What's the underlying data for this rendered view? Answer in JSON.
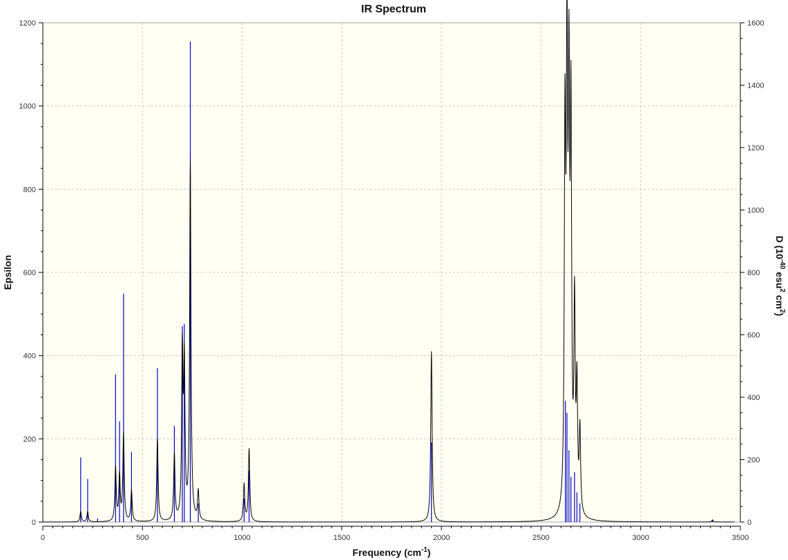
{
  "chart_data": {
    "type": "line",
    "title": "IR Spectrum",
    "xlabel": "Frequency (cm",
    "xlabel_sup": "-1",
    "xlabel_tail": ")",
    "ylabel": "Epsilon",
    "y2label": {
      "a": "D (10",
      "a_sup": "-40",
      "b": " esu",
      "b_sup": "2",
      "c": " cm",
      "c_sup": "2",
      "d": ")"
    },
    "xlim": [
      0,
      3500
    ],
    "ylim": [
      0,
      1200
    ],
    "y2lim": [
      0,
      1600
    ],
    "x_ticks": [
      0,
      500,
      1000,
      1500,
      2000,
      2500,
      3000,
      3500
    ],
    "y_ticks": [
      0,
      200,
      400,
      600,
      800,
      1000,
      1200
    ],
    "y2_ticks": [
      0,
      200,
      400,
      600,
      800,
      1000,
      1200,
      1400,
      1600
    ],
    "grid": true,
    "colors": {
      "spectrum": "#000000",
      "sticks": "#0000c8",
      "plot_bg": "#fffff4",
      "grid": "#c8c8c8"
    },
    "series": [
      {
        "kind": "stick",
        "axis": "y2",
        "x": [
          190,
          225,
          275,
          365,
          385,
          405,
          445,
          575,
          660,
          700,
          710,
          740,
          780,
          1010,
          1035,
          1950,
          2622,
          2630,
          2640,
          2650,
          2668,
          2680,
          2695,
          3360
        ],
        "values": [
          207,
          138,
          12,
          473,
          323,
          732,
          225,
          493,
          308,
          628,
          635,
          1540,
          60,
          75,
          165,
          255,
          388,
          350,
          230,
          145,
          160,
          95,
          60,
          8
        ]
      },
      {
        "kind": "spectrum",
        "axis": "y",
        "peaks": [
          {
            "x": 190,
            "height": 25,
            "width": 8
          },
          {
            "x": 225,
            "height": 25,
            "width": 8
          },
          {
            "x": 365,
            "height": 130,
            "width": 8
          },
          {
            "x": 385,
            "height": 110,
            "width": 8
          },
          {
            "x": 405,
            "height": 210,
            "width": 8
          },
          {
            "x": 445,
            "height": 75,
            "width": 8
          },
          {
            "x": 575,
            "height": 200,
            "width": 8
          },
          {
            "x": 660,
            "height": 160,
            "width": 8
          },
          {
            "x": 700,
            "height": 395,
            "width": 8
          },
          {
            "x": 710,
            "height": 360,
            "width": 8
          },
          {
            "x": 740,
            "height": 860,
            "width": 8
          },
          {
            "x": 780,
            "height": 70,
            "width": 8
          },
          {
            "x": 1010,
            "height": 90,
            "width": 8
          },
          {
            "x": 1035,
            "height": 175,
            "width": 8
          },
          {
            "x": 1950,
            "height": 410,
            "width": 8
          },
          {
            "x": 2620,
            "height": 880,
            "width": 8
          },
          {
            "x": 2630,
            "height": 1030,
            "width": 8
          },
          {
            "x": 2640,
            "height": 920,
            "width": 8
          },
          {
            "x": 2650,
            "height": 900,
            "width": 8
          },
          {
            "x": 2668,
            "height": 480,
            "width": 8
          },
          {
            "x": 2680,
            "height": 290,
            "width": 8
          },
          {
            "x": 2695,
            "height": 200,
            "width": 8
          },
          {
            "x": 3360,
            "height": 5,
            "width": 8
          }
        ]
      }
    ]
  }
}
